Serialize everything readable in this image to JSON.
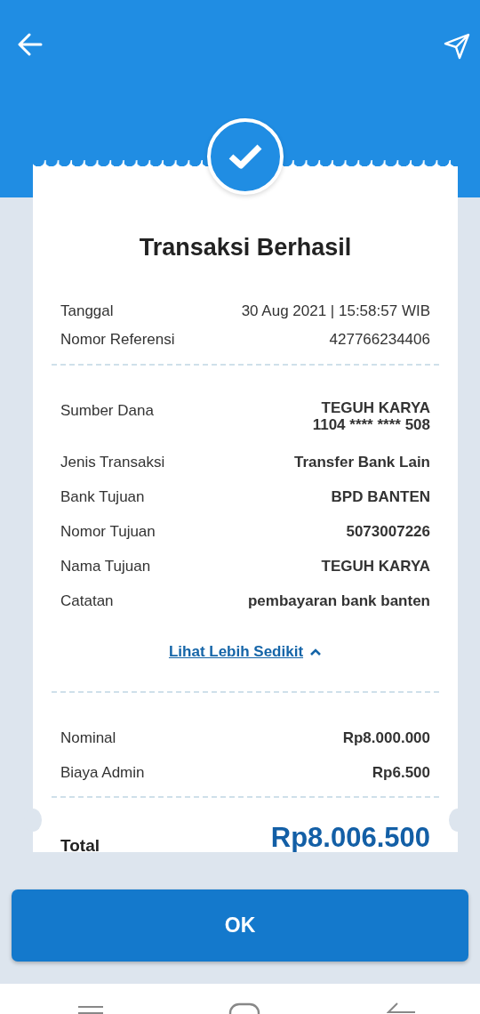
{
  "receipt": {
    "title": "Transaksi Berhasil",
    "meta_rows": [
      {
        "label": "Tanggal",
        "value": "30 Aug 2021 | 15:58:57 WIB"
      },
      {
        "label": "Nomor Referensi",
        "value": "427766234406"
      }
    ],
    "detail_rows": [
      {
        "label": "Sumber Dana",
        "value": "TEGUH KARYA",
        "subvalue": "1104 **** **** 508"
      },
      {
        "label": "Jenis Transaksi",
        "value": "Transfer Bank Lain"
      },
      {
        "label": "Bank Tujuan",
        "value": "BPD BANTEN"
      },
      {
        "label": "Nomor Tujuan",
        "value": "5073007226"
      },
      {
        "label": "Nama Tujuan",
        "value": "TEGUH KARYA"
      },
      {
        "label": "Catatan",
        "value": "pembayaran bank banten"
      }
    ],
    "toggle_link": {
      "label": "Lihat Lebih Sedikit",
      "expanded": true
    },
    "amount_rows": [
      {
        "label": "Nominal",
        "value": "Rp8.000.000"
      },
      {
        "label": "Biaya Admin",
        "value": "Rp6.500"
      }
    ],
    "total": {
      "label": "Total",
      "value": "Rp8.006.500"
    }
  },
  "ok_button": {
    "label": "OK"
  }
}
